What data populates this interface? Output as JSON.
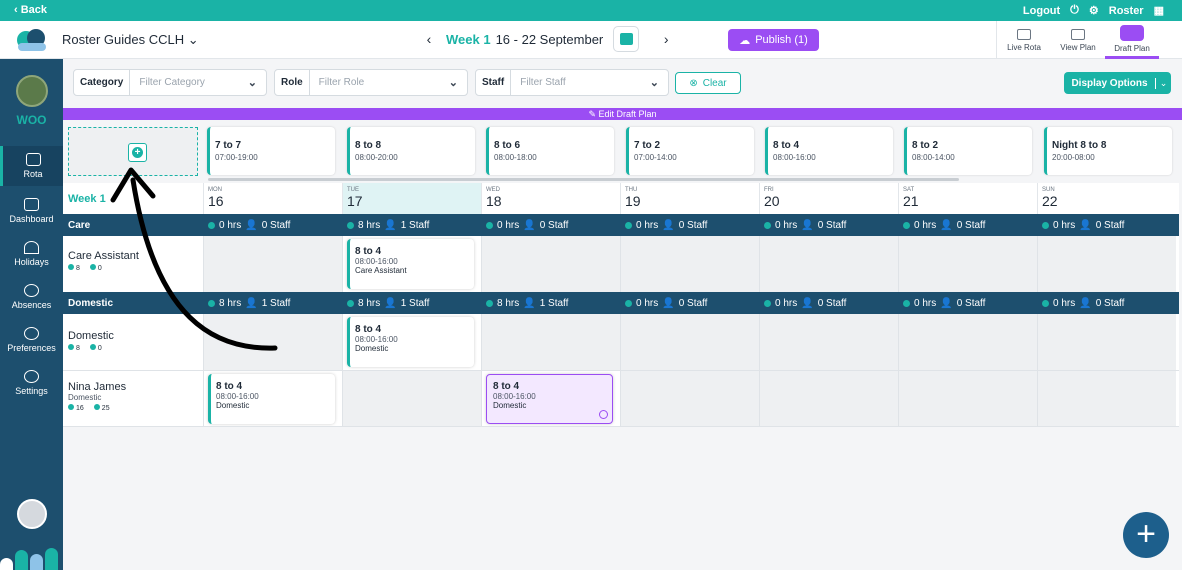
{
  "topbar": {
    "back": "‹ Back",
    "logout": "Logout",
    "roster": "Roster"
  },
  "header": {
    "org_name": "Roster Guides CCLH",
    "week_label": "Week 1",
    "week_range": "16 - 22 September",
    "publish": "Publish (1)",
    "views": [
      "Live Rota",
      "View Plan",
      "Draft Plan"
    ]
  },
  "sidebar": {
    "org_code": "WOO",
    "items": [
      "Rota",
      "Dashboard",
      "Holidays",
      "Absences",
      "Preferences",
      "Settings"
    ]
  },
  "filters": {
    "category_label": "Category",
    "category_placeholder": "Filter Category",
    "role_label": "Role",
    "role_placeholder": "Filter Role",
    "staff_label": "Staff",
    "staff_placeholder": "Filter Staff",
    "clear": "Clear",
    "display_options": "Display Options"
  },
  "edit_bar": "✎ Edit Draft Plan",
  "templates": [
    {
      "name": "7 to 7",
      "time": "07:00-19:00"
    },
    {
      "name": "8 to 8",
      "time": "08:00-20:00"
    },
    {
      "name": "8 to 6",
      "time": "08:00-18:00"
    },
    {
      "name": "7 to 2",
      "time": "07:00-14:00"
    },
    {
      "name": "8 to 4",
      "time": "08:00-16:00"
    },
    {
      "name": "8 to 2",
      "time": "08:00-14:00"
    },
    {
      "name": "Night 8 to 8",
      "time": "20:00-08:00"
    }
  ],
  "grid": {
    "week": "Week 1",
    "days": [
      {
        "name": "MON",
        "num": "16"
      },
      {
        "name": "TUE",
        "num": "17"
      },
      {
        "name": "WED",
        "num": "18"
      },
      {
        "name": "THU",
        "num": "19"
      },
      {
        "name": "FRI",
        "num": "20"
      },
      {
        "name": "SAT",
        "num": "21"
      },
      {
        "name": "SUN",
        "num": "22"
      }
    ],
    "care": {
      "name": "Care",
      "stats": [
        {
          "hrs": "0 hrs",
          "staff": "0 Staff"
        },
        {
          "hrs": "8 hrs",
          "staff": "1 Staff"
        },
        {
          "hrs": "0 hrs",
          "staff": "0 Staff"
        },
        {
          "hrs": "0 hrs",
          "staff": "0 Staff"
        },
        {
          "hrs": "0 hrs",
          "staff": "0 Staff"
        },
        {
          "hrs": "0 hrs",
          "staff": "0 Staff"
        },
        {
          "hrs": "0 hrs",
          "staff": "0 Staff"
        }
      ],
      "role": {
        "name": "Care Assistant",
        "hrs": "8",
        "count": "0"
      },
      "shift": {
        "name": "8 to 4",
        "time": "08:00-16:00",
        "role": "Care Assistant"
      }
    },
    "domestic": {
      "name": "Domestic",
      "stats": [
        {
          "hrs": "8 hrs",
          "staff": "1 Staff"
        },
        {
          "hrs": "8 hrs",
          "staff": "1 Staff"
        },
        {
          "hrs": "8 hrs",
          "staff": "1 Staff"
        },
        {
          "hrs": "0 hrs",
          "staff": "0 Staff"
        },
        {
          "hrs": "0 hrs",
          "staff": "0 Staff"
        },
        {
          "hrs": "0 hrs",
          "staff": "0 Staff"
        },
        {
          "hrs": "0 hrs",
          "staff": "0 Staff"
        }
      ],
      "role": {
        "name": "Domestic",
        "hrs": "8",
        "count": "0"
      },
      "shift": {
        "name": "8 to 4",
        "time": "08:00-16:00",
        "role": "Domestic"
      }
    },
    "staff": {
      "name": "Nina James",
      "role": "Domestic",
      "hrs": "16",
      "count": "25",
      "shift_mon": {
        "name": "8 to 4",
        "time": "08:00-16:00",
        "role": "Domestic"
      },
      "shift_wed": {
        "name": "8 to 4",
        "time": "08:00-16:00",
        "role": "Domestic"
      }
    }
  },
  "colors": {
    "teal": "#1ab3a6",
    "navy": "#1d4f6e",
    "purple": "#9b4df3"
  }
}
